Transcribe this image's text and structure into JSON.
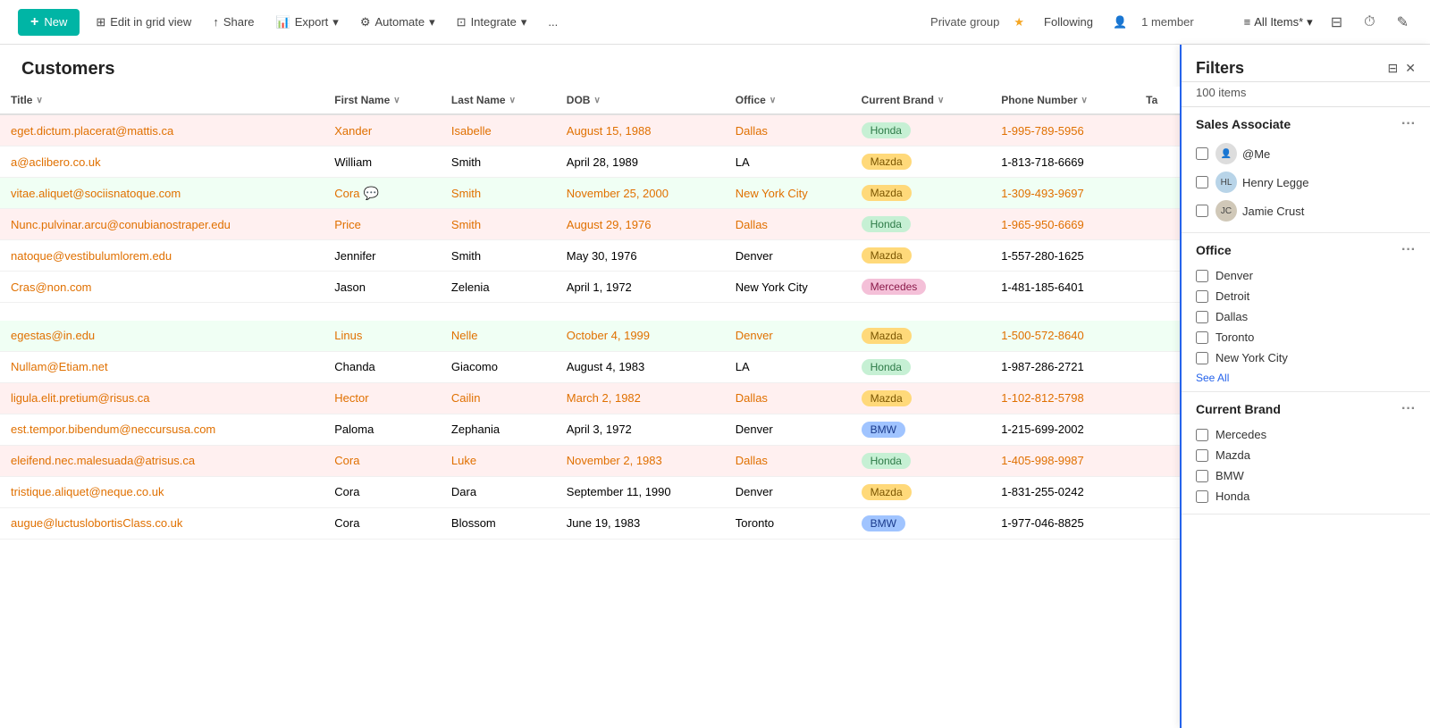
{
  "topbar": {
    "new_label": "New",
    "edit_label": "Edit in grid view",
    "share_label": "Share",
    "export_label": "Export",
    "automate_label": "Automate",
    "integrate_label": "Integrate",
    "more_label": "...",
    "private_group_label": "Private group",
    "following_label": "Following",
    "members_label": "1 member",
    "all_items_label": "All Items*",
    "filter_icon": "⊞",
    "clock_icon": "⏱",
    "edit_icon": "✎"
  },
  "page": {
    "title": "Customers",
    "item_count": "100 items"
  },
  "columns": [
    {
      "key": "title",
      "label": "Title"
    },
    {
      "key": "first_name",
      "label": "First Name"
    },
    {
      "key": "last_name",
      "label": "Last Name"
    },
    {
      "key": "dob",
      "label": "DOB"
    },
    {
      "key": "office",
      "label": "Office"
    },
    {
      "key": "current_brand",
      "label": "Current Brand"
    },
    {
      "key": "phone_number",
      "label": "Phone Number"
    },
    {
      "key": "ta",
      "label": "Ta"
    }
  ],
  "rows": [
    {
      "title": "eget.dictum.placerat@mattis.ca",
      "first": "Xander",
      "last": "Isabelle",
      "dob": "August 15, 1988",
      "office": "Dallas",
      "brand": "Honda",
      "phone": "1-995-789-5956",
      "row_type": "pink",
      "highlight": true
    },
    {
      "title": "a@aclibero.co.uk",
      "first": "William",
      "last": "Smith",
      "dob": "April 28, 1989",
      "office": "LA",
      "brand": "Mazda",
      "phone": "1-813-718-6669",
      "row_type": "normal",
      "highlight": false
    },
    {
      "title": "vitae.aliquet@sociisnatoque.com",
      "first": "Cora",
      "last": "Smith",
      "dob": "November 25, 2000",
      "office": "New York City",
      "brand": "Mazda",
      "phone": "1-309-493-9697",
      "row_type": "green",
      "highlight": true,
      "has_msg": true
    },
    {
      "title": "Nunc.pulvinar.arcu@conubianostraper.edu",
      "first": "Price",
      "last": "Smith",
      "dob": "August 29, 1976",
      "office": "Dallas",
      "brand": "Honda",
      "phone": "1-965-950-6669",
      "row_type": "pink",
      "highlight": true
    },
    {
      "title": "natoque@vestibulumlorem.edu",
      "first": "Jennifer",
      "last": "Smith",
      "dob": "May 30, 1976",
      "office": "Denver",
      "brand": "Mazda",
      "phone": "1-557-280-1625",
      "row_type": "normal",
      "highlight": false
    },
    {
      "title": "Cras@non.com",
      "first": "Jason",
      "last": "Zelenia",
      "dob": "April 1, 1972",
      "office": "New York City",
      "brand": "Mercedes",
      "phone": "1-481-185-6401",
      "row_type": "normal",
      "highlight": false
    },
    {
      "title": "",
      "first": "",
      "last": "",
      "dob": "",
      "office": "",
      "brand": "",
      "phone": "",
      "row_type": "normal",
      "highlight": false,
      "spacer": true
    },
    {
      "title": "egestas@in.edu",
      "first": "Linus",
      "last": "Nelle",
      "dob": "October 4, 1999",
      "office": "Denver",
      "brand": "Mazda",
      "phone": "1-500-572-8640",
      "row_type": "green",
      "highlight": true
    },
    {
      "title": "Nullam@Etiam.net",
      "first": "Chanda",
      "last": "Giacomo",
      "dob": "August 4, 1983",
      "office": "LA",
      "brand": "Honda",
      "phone": "1-987-286-2721",
      "row_type": "normal",
      "highlight": false
    },
    {
      "title": "ligula.elit.pretium@risus.ca",
      "first": "Hector",
      "last": "Cailin",
      "dob": "March 2, 1982",
      "office": "Dallas",
      "brand": "Mazda",
      "phone": "1-102-812-5798",
      "row_type": "pink",
      "highlight": true
    },
    {
      "title": "est.tempor.bibendum@neccursusa.com",
      "first": "Paloma",
      "last": "Zephania",
      "dob": "April 3, 1972",
      "office": "Denver",
      "brand": "BMW",
      "phone": "1-215-699-2002",
      "row_type": "normal",
      "highlight": false
    },
    {
      "title": "eleifend.nec.malesuada@atrisus.ca",
      "first": "Cora",
      "last": "Luke",
      "dob": "November 2, 1983",
      "office": "Dallas",
      "brand": "Honda",
      "phone": "1-405-998-9987",
      "row_type": "pink",
      "highlight": true
    },
    {
      "title": "tristique.aliquet@neque.co.uk",
      "first": "Cora",
      "last": "Dara",
      "dob": "September 11, 1990",
      "office": "Denver",
      "brand": "Mazda",
      "phone": "1-831-255-0242",
      "row_type": "normal",
      "highlight": false
    },
    {
      "title": "augue@luctuslobortisClass.co.uk",
      "first": "Cora",
      "last": "Blossom",
      "dob": "June 19, 1983",
      "office": "Toronto",
      "brand": "BMW",
      "phone": "1-977-046-8825",
      "row_type": "normal",
      "highlight": false
    }
  ],
  "filters": {
    "title": "Filters",
    "count": "100 items",
    "sections": [
      {
        "key": "sales_associate",
        "label": "Sales Associate",
        "items": [
          {
            "key": "me",
            "label": "@Me",
            "has_avatar": true,
            "avatar_type": "me"
          },
          {
            "key": "henry",
            "label": "Henry Legge",
            "has_avatar": true,
            "avatar_type": "photo"
          },
          {
            "key": "jamie",
            "label": "Jamie Crust",
            "has_avatar": true,
            "avatar_type": "photo"
          }
        ]
      },
      {
        "key": "office",
        "label": "Office",
        "items": [
          {
            "key": "denver",
            "label": "Denver"
          },
          {
            "key": "detroit",
            "label": "Detroit"
          },
          {
            "key": "dallas",
            "label": "Dallas"
          },
          {
            "key": "toronto",
            "label": "Toronto"
          },
          {
            "key": "nyc",
            "label": "New York City"
          }
        ],
        "see_all": "See All"
      },
      {
        "key": "current_brand",
        "label": "Current Brand",
        "items": [
          {
            "key": "mercedes",
            "label": "Mercedes"
          },
          {
            "key": "mazda",
            "label": "Mazda"
          },
          {
            "key": "bmw",
            "label": "BMW"
          },
          {
            "key": "honda",
            "label": "Honda"
          }
        ]
      }
    ]
  }
}
